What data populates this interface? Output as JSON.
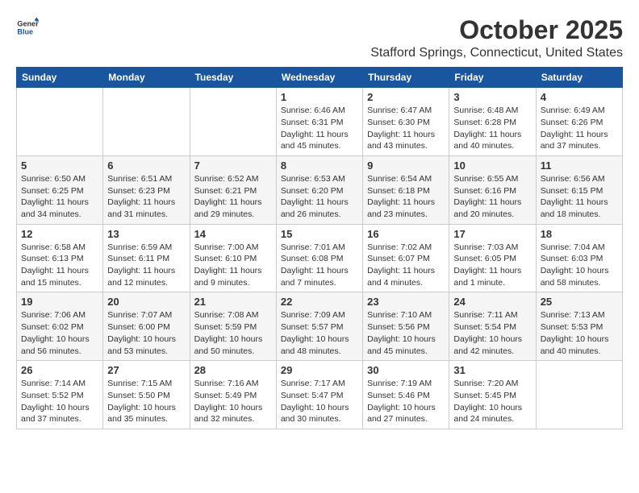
{
  "header": {
    "logo_general": "General",
    "logo_blue": "Blue",
    "month_title": "October 2025",
    "location": "Stafford Springs, Connecticut, United States"
  },
  "days_of_week": [
    "Sunday",
    "Monday",
    "Tuesday",
    "Wednesday",
    "Thursday",
    "Friday",
    "Saturday"
  ],
  "weeks": [
    [
      {
        "day": "",
        "info": ""
      },
      {
        "day": "",
        "info": ""
      },
      {
        "day": "",
        "info": ""
      },
      {
        "day": "1",
        "info": "Sunrise: 6:46 AM\nSunset: 6:31 PM\nDaylight: 11 hours and 45 minutes."
      },
      {
        "day": "2",
        "info": "Sunrise: 6:47 AM\nSunset: 6:30 PM\nDaylight: 11 hours and 43 minutes."
      },
      {
        "day": "3",
        "info": "Sunrise: 6:48 AM\nSunset: 6:28 PM\nDaylight: 11 hours and 40 minutes."
      },
      {
        "day": "4",
        "info": "Sunrise: 6:49 AM\nSunset: 6:26 PM\nDaylight: 11 hours and 37 minutes."
      }
    ],
    [
      {
        "day": "5",
        "info": "Sunrise: 6:50 AM\nSunset: 6:25 PM\nDaylight: 11 hours and 34 minutes."
      },
      {
        "day": "6",
        "info": "Sunrise: 6:51 AM\nSunset: 6:23 PM\nDaylight: 11 hours and 31 minutes."
      },
      {
        "day": "7",
        "info": "Sunrise: 6:52 AM\nSunset: 6:21 PM\nDaylight: 11 hours and 29 minutes."
      },
      {
        "day": "8",
        "info": "Sunrise: 6:53 AM\nSunset: 6:20 PM\nDaylight: 11 hours and 26 minutes."
      },
      {
        "day": "9",
        "info": "Sunrise: 6:54 AM\nSunset: 6:18 PM\nDaylight: 11 hours and 23 minutes."
      },
      {
        "day": "10",
        "info": "Sunrise: 6:55 AM\nSunset: 6:16 PM\nDaylight: 11 hours and 20 minutes."
      },
      {
        "day": "11",
        "info": "Sunrise: 6:56 AM\nSunset: 6:15 PM\nDaylight: 11 hours and 18 minutes."
      }
    ],
    [
      {
        "day": "12",
        "info": "Sunrise: 6:58 AM\nSunset: 6:13 PM\nDaylight: 11 hours and 15 minutes."
      },
      {
        "day": "13",
        "info": "Sunrise: 6:59 AM\nSunset: 6:11 PM\nDaylight: 11 hours and 12 minutes."
      },
      {
        "day": "14",
        "info": "Sunrise: 7:00 AM\nSunset: 6:10 PM\nDaylight: 11 hours and 9 minutes."
      },
      {
        "day": "15",
        "info": "Sunrise: 7:01 AM\nSunset: 6:08 PM\nDaylight: 11 hours and 7 minutes."
      },
      {
        "day": "16",
        "info": "Sunrise: 7:02 AM\nSunset: 6:07 PM\nDaylight: 11 hours and 4 minutes."
      },
      {
        "day": "17",
        "info": "Sunrise: 7:03 AM\nSunset: 6:05 PM\nDaylight: 11 hours and 1 minute."
      },
      {
        "day": "18",
        "info": "Sunrise: 7:04 AM\nSunset: 6:03 PM\nDaylight: 10 hours and 58 minutes."
      }
    ],
    [
      {
        "day": "19",
        "info": "Sunrise: 7:06 AM\nSunset: 6:02 PM\nDaylight: 10 hours and 56 minutes."
      },
      {
        "day": "20",
        "info": "Sunrise: 7:07 AM\nSunset: 6:00 PM\nDaylight: 10 hours and 53 minutes."
      },
      {
        "day": "21",
        "info": "Sunrise: 7:08 AM\nSunset: 5:59 PM\nDaylight: 10 hours and 50 minutes."
      },
      {
        "day": "22",
        "info": "Sunrise: 7:09 AM\nSunset: 5:57 PM\nDaylight: 10 hours and 48 minutes."
      },
      {
        "day": "23",
        "info": "Sunrise: 7:10 AM\nSunset: 5:56 PM\nDaylight: 10 hours and 45 minutes."
      },
      {
        "day": "24",
        "info": "Sunrise: 7:11 AM\nSunset: 5:54 PM\nDaylight: 10 hours and 42 minutes."
      },
      {
        "day": "25",
        "info": "Sunrise: 7:13 AM\nSunset: 5:53 PM\nDaylight: 10 hours and 40 minutes."
      }
    ],
    [
      {
        "day": "26",
        "info": "Sunrise: 7:14 AM\nSunset: 5:52 PM\nDaylight: 10 hours and 37 minutes."
      },
      {
        "day": "27",
        "info": "Sunrise: 7:15 AM\nSunset: 5:50 PM\nDaylight: 10 hours and 35 minutes."
      },
      {
        "day": "28",
        "info": "Sunrise: 7:16 AM\nSunset: 5:49 PM\nDaylight: 10 hours and 32 minutes."
      },
      {
        "day": "29",
        "info": "Sunrise: 7:17 AM\nSunset: 5:47 PM\nDaylight: 10 hours and 30 minutes."
      },
      {
        "day": "30",
        "info": "Sunrise: 7:19 AM\nSunset: 5:46 PM\nDaylight: 10 hours and 27 minutes."
      },
      {
        "day": "31",
        "info": "Sunrise: 7:20 AM\nSunset: 5:45 PM\nDaylight: 10 hours and 24 minutes."
      },
      {
        "day": "",
        "info": ""
      }
    ]
  ]
}
